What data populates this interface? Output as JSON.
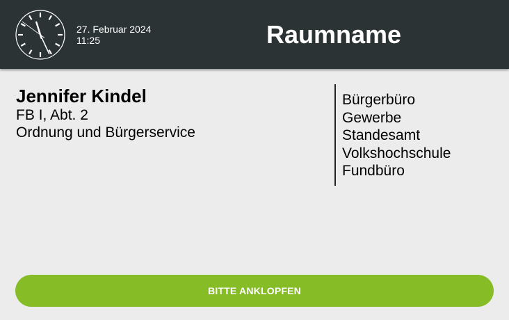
{
  "header": {
    "date": "27. Februar 2024",
    "time": "11:25",
    "room_name": "Raumname",
    "clock": {
      "hour": 11,
      "minute": 25,
      "second": 51
    }
  },
  "person": {
    "name": "Jennifer Kindel",
    "department": "FB I, Abt. 2",
    "division": "Ordnung und Bürgerservice"
  },
  "services": [
    "Bürgerbüro",
    "Gewerbe",
    "Standesamt",
    "Volkshochschule",
    "Fundbüro"
  ],
  "action": {
    "knock_label": "BITTE ANKLOPFEN"
  },
  "colors": {
    "header_bg": "#2b3335",
    "page_bg": "#ececec",
    "accent": "#86bd27"
  }
}
